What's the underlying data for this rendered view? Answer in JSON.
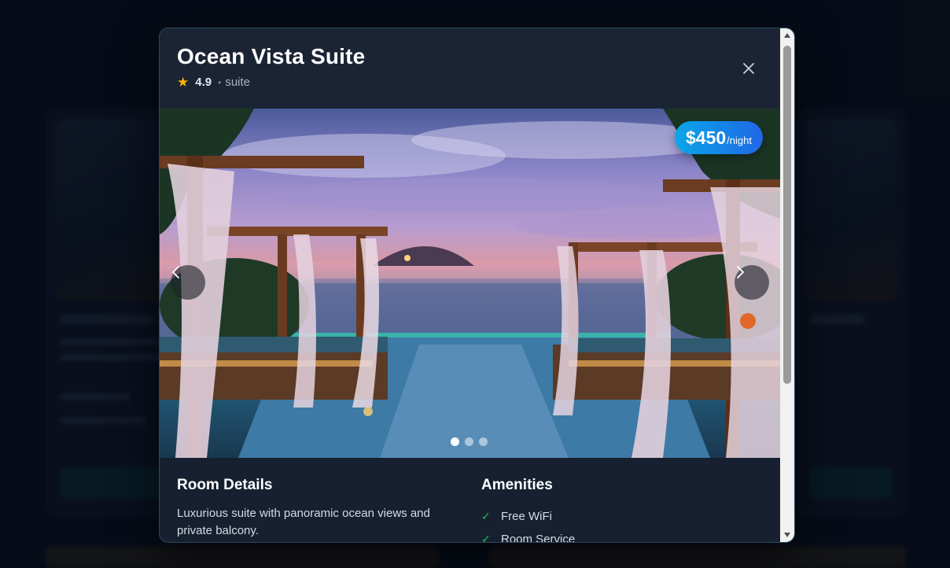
{
  "modal": {
    "title": "Ocean Vista Suite",
    "rating": "4.9",
    "separator": "•",
    "room_type": "suite",
    "price": {
      "amount": "$450",
      "unit": "/night"
    },
    "gallery": {
      "image_count": 3,
      "active_index": 0
    },
    "details": {
      "heading": "Room Details",
      "description": "Luxurious suite with panoramic ocean views and private balcony."
    },
    "amenities": {
      "heading": "Amenities",
      "items": [
        "Free WiFi",
        "Room Service"
      ]
    }
  },
  "icons": {
    "rating": "star-icon",
    "close": "close-icon",
    "prev": "chevron-left-icon",
    "next": "chevron-right-icon",
    "amenity": "check-icon"
  },
  "colors": {
    "accent_gradient_start": "#0aa6e8",
    "accent_gradient_end": "#2067e6",
    "star": "#f5b400",
    "check": "#22c55e"
  }
}
